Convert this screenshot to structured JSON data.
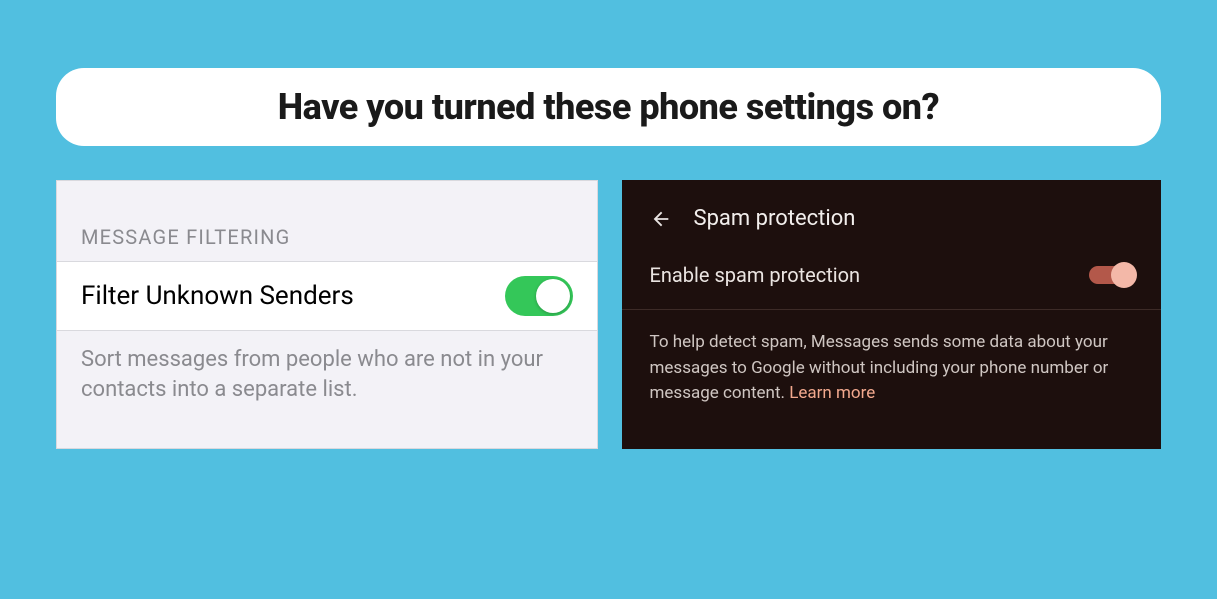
{
  "title": "Have you turned these phone settings on?",
  "ios": {
    "section_header": "MESSAGE FILTERING",
    "row_label": "Filter Unknown Senders",
    "toggle_on": true,
    "description": "Sort messages from people who are not in your contacts into a separate list."
  },
  "android": {
    "screen_title": "Spam protection",
    "row_label": "Enable spam protection",
    "toggle_on": true,
    "description": "To help detect spam, Messages sends some data about your messages to Google without including your phone number or message content. ",
    "learn_more": "Learn more"
  }
}
